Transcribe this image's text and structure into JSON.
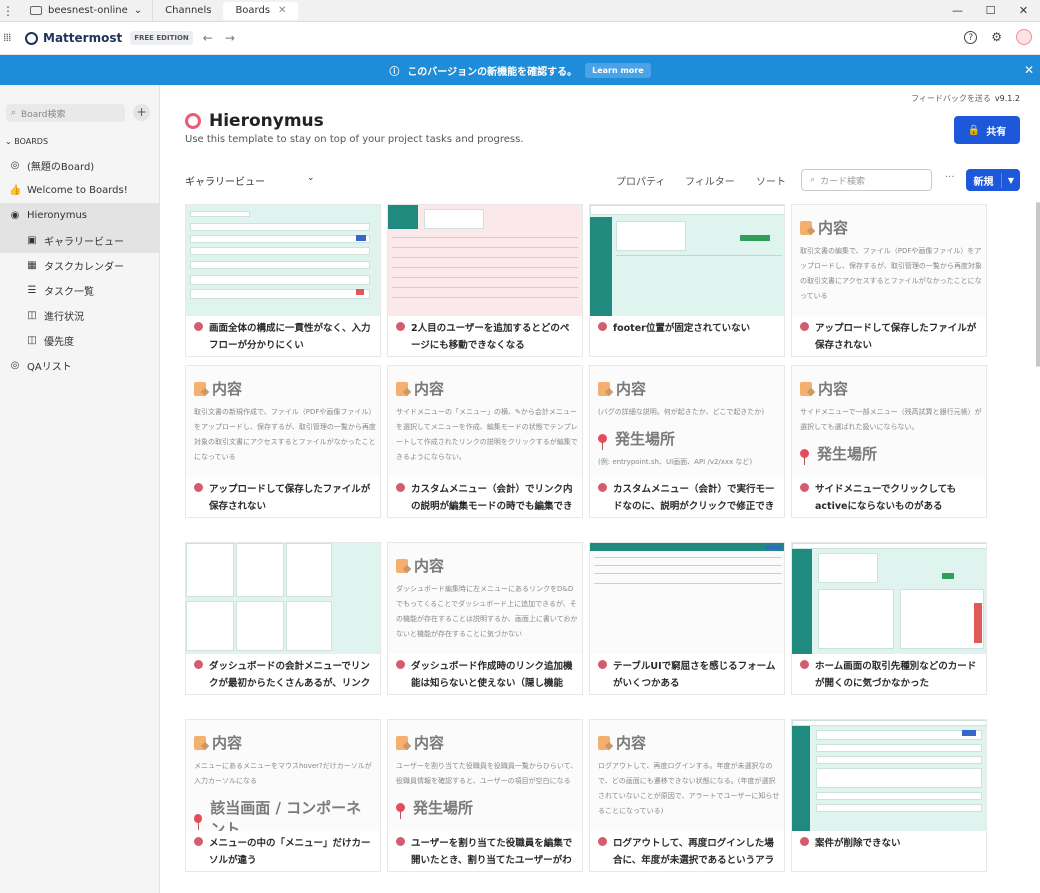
{
  "titlebar": {
    "workspace": "beesnest-online",
    "tabs": [
      "Channels",
      "Boards"
    ],
    "close": "✕",
    "win": [
      "—",
      "☐",
      "✕"
    ]
  },
  "header": {
    "brand": "Mattermost",
    "edition": "FREE EDITION",
    "help": "?",
    "settings": "⚙"
  },
  "banner": {
    "text": "このバージョンの新機能を確認する。",
    "learn": "Learn more"
  },
  "sidebar": {
    "search_placeholder": "Board検索",
    "section": "BOARDS",
    "items": [
      {
        "label": "(無題のBoard)",
        "icon": "◎"
      },
      {
        "label": "Welcome to Boards!",
        "icon": "👍"
      },
      {
        "label": "Hieronymus",
        "icon": "◉"
      },
      {
        "label": "ギャラリービュー",
        "icon": "▣"
      },
      {
        "label": "タスクカレンダー",
        "icon": "▦"
      },
      {
        "label": "タスク一覧",
        "icon": "☰"
      },
      {
        "label": "進行状況",
        "icon": "◫"
      },
      {
        "label": "優先度",
        "icon": "◫"
      },
      {
        "label": "QAリスト",
        "icon": "◎"
      }
    ]
  },
  "board": {
    "feedback": "フィードバックを送る",
    "version": "v9.1.2",
    "title": "Hieronymus",
    "subtitle": "Use this template to stay on top of your project tasks and progress.",
    "share": "共有",
    "view": "ギャラリービュー",
    "options": [
      "プロパティ",
      "フィルター",
      "ソート"
    ],
    "search_placeholder": "カード検索",
    "more": "···",
    "new": "新規"
  },
  "cards": [
    {
      "title": "画面全体の構成に一貫性がなく、入力フローが分かりにくい",
      "preview": "teal"
    },
    {
      "title": "2人目のユーザーを追加するとどのページにも移動できなくなる",
      "preview": "pink"
    },
    {
      "title": "footer位置が固定されていない",
      "preview": "teal2"
    },
    {
      "title": "アップロードして保存したファイルが保存されない",
      "heading": "内容",
      "text": "取引文書の編集で、ファイル（PDFや画像ファイル）をアップロードし、保存するが、取引管理の一覧から再度対象の取引文書にアクセスするとファイルがなかったことになっている"
    },
    {
      "title": "アップロードして保存したファイルが保存されない",
      "heading": "内容",
      "text": "取引文書の新規作成で、ファイル（PDFや画像ファイル）をアップロードし、保存するが、取引管理の一覧から再度対象の取引文書にアクセスするとファイルがなかったことになっている"
    },
    {
      "title": "カスタムメニュー（会計）でリンク内の説明が編集モードの時でも編集できない",
      "heading": "内容",
      "text": "サイドメニューの「メニュー」の横、✎から会計メニューを選択してメニューを作成、編集モードの状態でテンプレートして作成されたリンクの説明をクリックするが編集できるようにならない。"
    },
    {
      "title": "カスタムメニュー（会計）で実行モードなのに、説明がクリックで修正できてしまう。",
      "heading": "内容",
      "text": "(バグの詳細な説明。何が起きたか、どこで起きたか)",
      "heading2": "発生場所",
      "text2": "(例: entrypoint.sh、UI画面、API /v2/xxx など)"
    },
    {
      "title": "サイドメニューでクリックしてもactiveにならないものがある",
      "heading": "内容",
      "text": "サイドメニューで一部メニュー（残高試算と銀行元帳）が選択しても選ばれた扱いにならない。",
      "heading2": "発生場所",
      "text2": ""
    },
    {
      "title": "ダッシュボードの会計メニューでリンクが最初からたくさんあるが、リンクであることに気づかない",
      "preview": "teal3"
    },
    {
      "title": "ダッシュボード作成時のリンク追加機能は知らないと使えない（隠し機能感）",
      "heading": "内容",
      "text": "ダッシュボード編集時に左メニューにあるリンクをD&Dでもってくることでダッシュボード上に追加できるが、その機能が存在することは説明するか、画面上に書いておかないと機能が存在することに気づかない"
    },
    {
      "title": "テーブルUIで窮屈さを感じるフォームがいくつかある",
      "preview": "white"
    },
    {
      "title": "ホーム画面の取引先種別などのカードが開くのに気づかなかった",
      "preview": "teal4"
    },
    {
      "title": "メニューの中の「メニュー」だけカーソルが違う",
      "heading": "内容",
      "text": "メニューにあるメニューをマウスhover?だけカーソルが入力カーソルになる",
      "heading2": "該当画面 / コンポーネント",
      "text2": ""
    },
    {
      "title": "ユーザーを割り当てた役職員を編集で開いたとき、割り当てたユーザーがわからなくなる",
      "heading": "内容",
      "text": "ユーザーを割り当てた役職員を役職員一覧からひらいて、役職員情報を確認すると、ユーザーの項目が空白になる",
      "heading2": "発生場所",
      "text2": ""
    },
    {
      "title": "ログアウトして、再度ログインした場合に、年度が未選択であるというアラートがでない。",
      "heading": "内容",
      "text": "ログアウトして、再度ログインする。年度が未選択なので、どの画面にも遷移できない状態になる。(年度が選択されていないことが原因で、アラートでユーザーに知らせることになっている)"
    },
    {
      "title": "案件が削除できない",
      "preview": "teal5"
    }
  ]
}
